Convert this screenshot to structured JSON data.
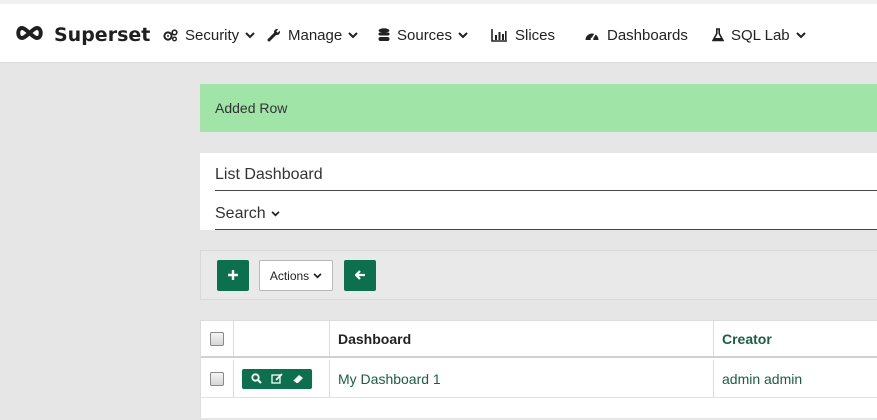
{
  "brand": {
    "name": "Superset"
  },
  "nav": {
    "items": [
      {
        "label": "Security",
        "icon": "cogs-icon",
        "has_dropdown": true
      },
      {
        "label": "Manage",
        "icon": "wrench-icon",
        "has_dropdown": true
      },
      {
        "label": "Sources",
        "icon": "database-icon",
        "has_dropdown": true
      },
      {
        "label": "Slices",
        "icon": "bar-chart-icon",
        "has_dropdown": false
      },
      {
        "label": "Dashboards",
        "icon": "dashboard-icon",
        "has_dropdown": false
      },
      {
        "label": "SQL Lab",
        "icon": "flask-icon",
        "has_dropdown": true
      }
    ]
  },
  "alert": {
    "message": "Added Row",
    "color": "#a0e4a8"
  },
  "panel": {
    "title": "List Dashboard",
    "search_label": "Search"
  },
  "toolbar": {
    "add_icon": "plus-icon",
    "actions_label": "Actions",
    "back_icon": "arrow-left-icon"
  },
  "table": {
    "columns": [
      "",
      "",
      "Dashboard",
      "Creator"
    ],
    "rows": [
      {
        "dashboard": "My Dashboard 1",
        "creator": "admin admin",
        "row_actions": [
          "search-icon",
          "edit-icon",
          "eraser-icon"
        ]
      }
    ]
  },
  "colors": {
    "accent": "#0c6f4d",
    "link": "#1a5e44"
  }
}
